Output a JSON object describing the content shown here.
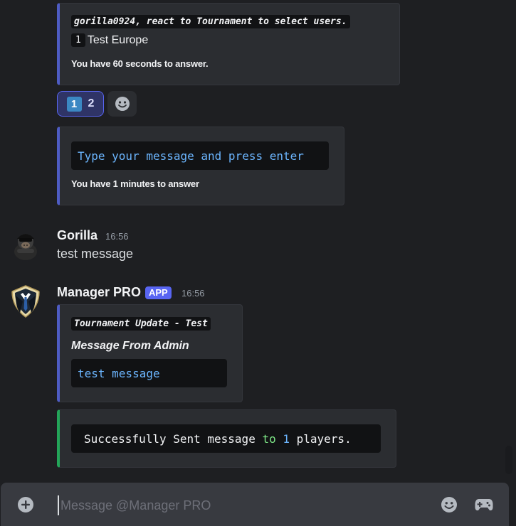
{
  "embed_reaction_prompt": {
    "prompt_text": "gorilla0924, react to Tournament to select users.",
    "option_number": "1",
    "option_label": "Test Europe",
    "timer_text": "You have 60 seconds to answer."
  },
  "reactions": {
    "first": {
      "emoji_label": "1",
      "count": "2"
    },
    "add_icon": "emoji-smile-icon"
  },
  "embed_message_prompt": {
    "code_text": "Type your message and press enter",
    "timer_text": "You have 1 minutes to answer"
  },
  "message_gorilla": {
    "username": "Gorilla",
    "timestamp": "16:56",
    "text": "test message"
  },
  "message_manager": {
    "username": "Manager PRO",
    "badge": "APP",
    "timestamp": "16:56",
    "embed_title": "Tournament Update - Test",
    "embed_subtitle": "Message From Admin",
    "embed_code": "test message",
    "result_part1": "Successfully Sent message ",
    "result_part2": "to",
    "result_part3": " ",
    "result_part4": "1",
    "result_part5": " players."
  },
  "composer": {
    "placeholder": "Message @Manager PRO"
  },
  "colors": {
    "background": "#1e1f22",
    "embed_bg": "#2b2d31",
    "embed_accent": "#4e5cc4",
    "success_accent": "#23a559",
    "blurple": "#5865f2",
    "code_blue": "#6cb6ff",
    "code_green": "#7ee787"
  }
}
